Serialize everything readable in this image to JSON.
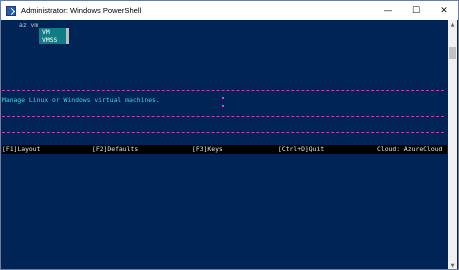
{
  "window": {
    "title": "Administrator: Windows PowerShell",
    "minimize_glyph": "—",
    "maximize_glyph": "☐",
    "close_glyph": "✕",
    "icon": "powershell-icon"
  },
  "terminal": {
    "prompt_text": "az vm",
    "completions": [
      "VM",
      "VMSS"
    ],
    "selected_completion": "VM",
    "description": "Manage Linux or Windows virtual machines.",
    "colors": {
      "background": "#012456",
      "completion_bg": "#0f7d84",
      "description": "#3ad7e0",
      "separator": "#c13fb2"
    }
  },
  "statusbar": {
    "layout": "[F1]Layout",
    "defaults": "[F2]Defaults",
    "keys": "[F3]Keys",
    "quit": "[Ctrl+D]Quit",
    "cloud": "Cloud: AzureCloud"
  },
  "scrollbar": {
    "up_glyph": "▲",
    "down_glyph": "▼"
  }
}
